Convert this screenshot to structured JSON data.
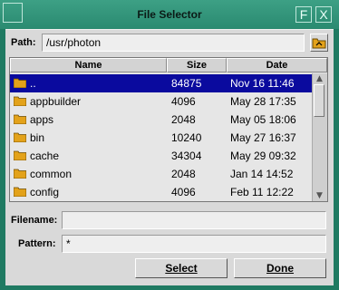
{
  "window": {
    "title": "File Selector",
    "min_glyph": "F",
    "close_glyph": "X"
  },
  "path": {
    "label": "Path:",
    "value": "/usr/photon"
  },
  "columns": {
    "name": "Name",
    "size": "Size",
    "date": "Date"
  },
  "files": [
    {
      "name": "..",
      "size": "84875",
      "date": "Nov 16 11:46",
      "selected": true
    },
    {
      "name": "appbuilder",
      "size": "4096",
      "date": "May 28 17:35"
    },
    {
      "name": "apps",
      "size": "2048",
      "date": "May 05 18:06"
    },
    {
      "name": "bin",
      "size": "10240",
      "date": "May 27 16:37"
    },
    {
      "name": "cache",
      "size": "34304",
      "date": "May 29 09:32"
    },
    {
      "name": "common",
      "size": "2048",
      "date": "Jan 14 14:52"
    },
    {
      "name": "config",
      "size": "4096",
      "date": "Feb 11 12:22"
    }
  ],
  "filename": {
    "label": "Filename:",
    "value": ""
  },
  "pattern": {
    "label": "Pattern:",
    "value": "*"
  },
  "buttons": {
    "select": "Select",
    "done": "Done"
  },
  "colors": {
    "selection": "#0a0a9e",
    "folder": "#e3a21a",
    "titlebar": "#2a8a70"
  }
}
